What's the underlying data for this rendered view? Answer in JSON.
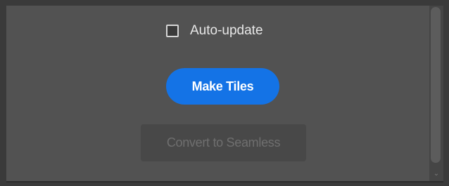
{
  "options": {
    "auto_update": {
      "label": "Auto-update",
      "checked": false
    }
  },
  "actions": {
    "make_tiles_label": "Make Tiles",
    "convert_label": "Convert to Seamless",
    "convert_enabled": false
  },
  "scrollbar": {
    "down_arrow_glyph": "⌄"
  },
  "colors": {
    "primary_button": "#1473e6",
    "panel_background": "#525252"
  }
}
